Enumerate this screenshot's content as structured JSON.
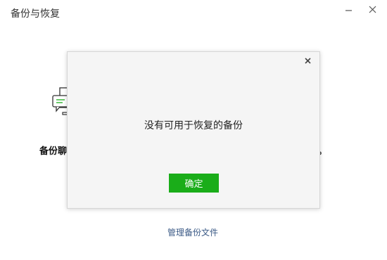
{
  "window": {
    "title": "备份与恢复"
  },
  "background": {
    "backup_label": "备份聊",
    "restore_label_partial": "。",
    "manage_link": "管理备份文件"
  },
  "dialog": {
    "message": "没有可用于恢复的备份",
    "confirm_label": "确定"
  },
  "colors": {
    "accent_green": "#1aad19",
    "link_blue": "#3b5a86"
  }
}
